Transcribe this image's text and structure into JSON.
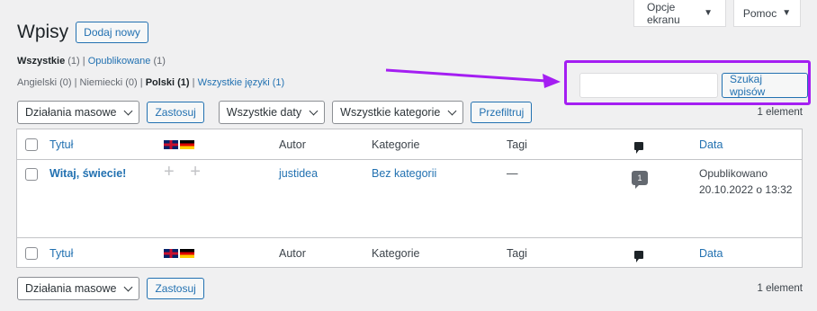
{
  "screen_meta": {
    "options_label": "Opcje ekranu",
    "help_label": "Pomoc",
    "caret": "▼"
  },
  "header": {
    "title": "Wpisy",
    "add_new": "Dodaj nowy"
  },
  "views": {
    "all": "Wszystkie",
    "all_count": "(1)",
    "sep": "|",
    "published": "Opublikowane",
    "published_count": "(1)"
  },
  "languages": [
    {
      "label": "Angielski (0)",
      "active": false
    },
    {
      "label": "Niemiecki (0)",
      "active": false
    },
    {
      "label": "Polski (1)",
      "active": true
    },
    {
      "label": "Wszystkie języki (1)",
      "active": false,
      "link": true
    }
  ],
  "search": {
    "value": "",
    "button": "Szukaj wpisów"
  },
  "tablenav_top": {
    "bulk": "Działania masowe",
    "apply": "Zastosuj",
    "dates": "Wszystkie daty",
    "categories": "Wszystkie kategorie",
    "filter": "Przefiltruj",
    "count": "1 element"
  },
  "table": {
    "headers": {
      "title": "Tytuł",
      "author": "Autor",
      "categories": "Kategorie",
      "tags": "Tagi",
      "date": "Data"
    },
    "rows": [
      {
        "title": "Witaj, świecie!",
        "author": "justidea",
        "category": "Bez kategorii",
        "tags": "—",
        "comments": "1",
        "status": "Opublikowano",
        "date": "20.10.2022 o 13:32",
        "lang_add": "+ +"
      }
    ]
  },
  "tablenav_bottom": {
    "bulk": "Działania masowe",
    "apply": "Zastosuj",
    "count": "1 element"
  },
  "colors": {
    "accent": "#2271b1",
    "highlight": "#a41ef2",
    "background": "#f0f0f1"
  },
  "icons": [
    "flag-uk-icon",
    "flag-de-icon",
    "comment-icon",
    "comment-count-bubble",
    "chevron-down-icon",
    "arrow-annotation"
  ]
}
